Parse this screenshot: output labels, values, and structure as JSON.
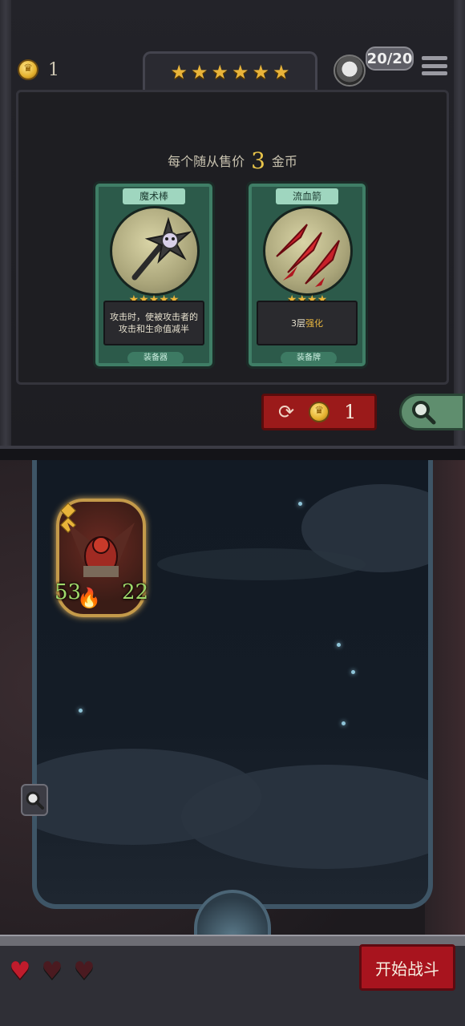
{
  "header": {
    "gold": "1",
    "tavern_stars": 6,
    "capacity": "20/20"
  },
  "shop": {
    "price_prefix": "每个随从售价",
    "price_value": "3",
    "price_suffix": "金币",
    "cards": [
      {
        "name": "魔术棒",
        "stars": 5,
        "description": "攻击时，使被攻击者的攻击和生命值减半",
        "type": "装备器"
      },
      {
        "name": "流血箭",
        "stars": 4,
        "description_prefix": "3层",
        "description_highlight": "强化",
        "type": "装备牌"
      }
    ],
    "refresh_cost": "1"
  },
  "board": {
    "minion": {
      "attack": "53",
      "health": "22"
    }
  },
  "footer": {
    "lives_total": 3,
    "lives_full": 1,
    "start_button_label": "开始战斗"
  },
  "colors": {
    "accent_gold": "#e9b43a",
    "card_green": "#2c5a4a",
    "button_red": "#a8141e",
    "stat_green": "#9fd86a"
  }
}
